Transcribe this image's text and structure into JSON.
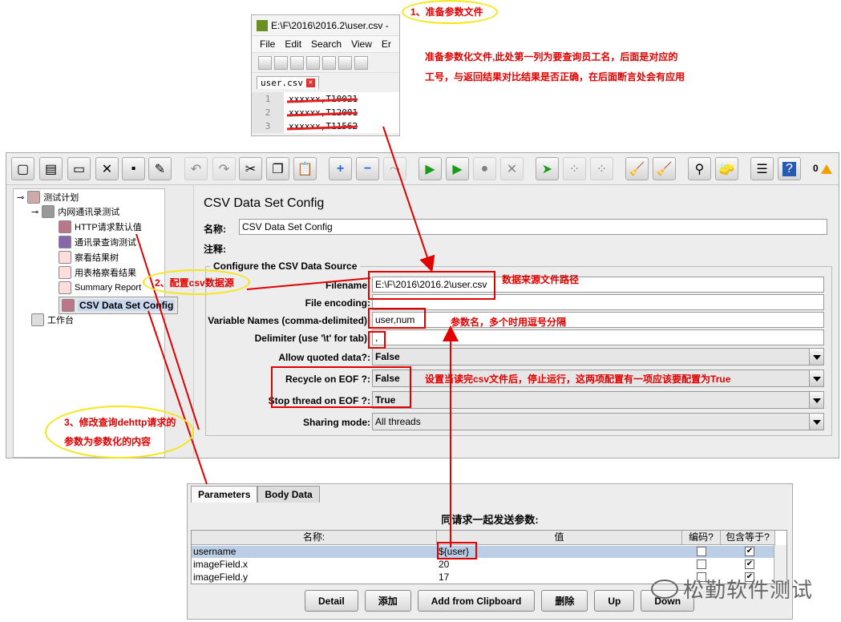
{
  "notepad": {
    "title": "E:\\F\\2016\\2016.2\\user.csv -",
    "menu": [
      "File",
      "Edit",
      "Search",
      "View",
      "Er"
    ],
    "tab": "user.csv",
    "lines": [
      {
        "num": "1",
        "text": "xxxxxx,T10021"
      },
      {
        "num": "2",
        "text": "xxxxxx,T12001"
      },
      {
        "num": "3",
        "text": "xxxxxx,T11562"
      }
    ]
  },
  "annotations": {
    "step1": "1、准备参数文件",
    "step1_desc_line1": "准备参数化文件,此处第一列为要查询员工名，后面是对应的",
    "step1_desc_line2": "工号，与返回结果对比结果是否正确，在后面断言处会有应用",
    "step2": "2、配置csv数据源",
    "step3_line1": "3、修改查询dehttp请求的",
    "step3_line2": "参数为参数化的内容",
    "file_path_note": "数据来源文件路径",
    "varnames_note": "参数名，多个时用逗号分隔",
    "eof_note": "设置当读完csv文件后，停止运行，这两项配置有一项应该要配置为True"
  },
  "toolbar": {
    "warning_count": "0"
  },
  "tree": {
    "root": "测试计划",
    "group": "内网通讯录测试",
    "items": [
      "HTTP请求默认值",
      "通讯录查询测试",
      "察看结果树",
      "用表格察看结果",
      "Summary Report",
      "CSV Data Set Config"
    ],
    "workbench": "工作台"
  },
  "config": {
    "heading": "CSV Data Set Config",
    "name_label": "名称:",
    "name_value": "CSV Data Set Config",
    "comment_label": "注释:",
    "section": "Configure the CSV Data Source",
    "filename_label": "Filename:",
    "filename_value": "E:\\F\\2016\\2016.2\\user.csv",
    "encoding_label": "File encoding:",
    "encoding_value": "",
    "varnames_label": "Variable Names (comma-delimited):",
    "varnames_value": "user,num",
    "delimiter_label": "Delimiter (use '\\t' for tab):",
    "delimiter_value": ",",
    "quoted_label": "Allow quoted data?:",
    "quoted_value": "False",
    "recycle_label": "Recycle on EOF ?:",
    "recycle_value": "False",
    "stop_label": "Stop thread on EOF ?:",
    "stop_value": "True",
    "sharing_label": "Sharing mode:",
    "sharing_value": "All threads"
  },
  "params": {
    "tabs": [
      "Parameters",
      "Body Data"
    ],
    "list_title": "同请求一起发送参数:",
    "headers": [
      "名称:",
      "值",
      "编码?",
      "包含等于?"
    ],
    "rows": [
      {
        "name": "username",
        "value": "${user}",
        "encode": false,
        "include_equals": true
      },
      {
        "name": "imageField.x",
        "value": "20",
        "encode": false,
        "include_equals": true
      },
      {
        "name": "imageField.y",
        "value": "17",
        "encode": false,
        "include_equals": true
      }
    ],
    "buttons": [
      "Detail",
      "添加",
      "Add from Clipboard",
      "删除",
      "Up",
      "Down"
    ]
  },
  "watermark": "松勤软件测试",
  "colors": {
    "annotation_red": "#e00000",
    "oval_yellow": "#f5e616",
    "selection": "#c7d7ee"
  }
}
